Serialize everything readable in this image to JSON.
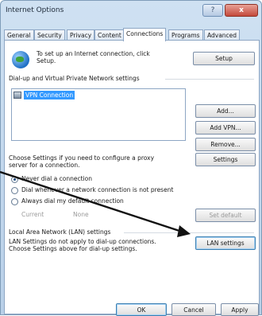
{
  "window": {
    "title": "Internet Options",
    "help_label": "?",
    "close_label": "x"
  },
  "tabs": [
    "General",
    "Security",
    "Privacy",
    "Content",
    "Connections",
    "Programs",
    "Advanced"
  ],
  "active_tab": "Connections",
  "setup": {
    "text_line1": "To set up an Internet connection, click",
    "text_line2": "Setup.",
    "button": "Setup"
  },
  "dialup": {
    "group_label": "Dial-up and Virtual Private Network settings",
    "list_items": [
      "VPN Connection"
    ],
    "add_button": "Add...",
    "add_vpn_button": "Add VPN...",
    "remove_button": "Remove...",
    "proxy_text_line1": "Choose Settings if you need to configure a proxy",
    "proxy_text_line2": "server for a connection.",
    "settings_button": "Settings",
    "radios": [
      {
        "label": "Never dial a connection",
        "checked": true
      },
      {
        "label": "Dial whenever a network connection is not present",
        "checked": false
      },
      {
        "label": "Always dial my default connection",
        "checked": false
      }
    ],
    "current_label": "Current",
    "current_value": "None",
    "set_default_button": "Set default"
  },
  "lan": {
    "group_label": "Local Area Network (LAN) settings",
    "text_line1": "LAN Settings do not apply to dial-up connections.",
    "text_line2": "Choose Settings above for dial-up settings.",
    "button": "LAN settings"
  },
  "footer": {
    "ok": "OK",
    "cancel": "Cancel",
    "apply": "Apply"
  },
  "colors": {
    "selection": "#3399ff",
    "arrow": "#111111"
  }
}
